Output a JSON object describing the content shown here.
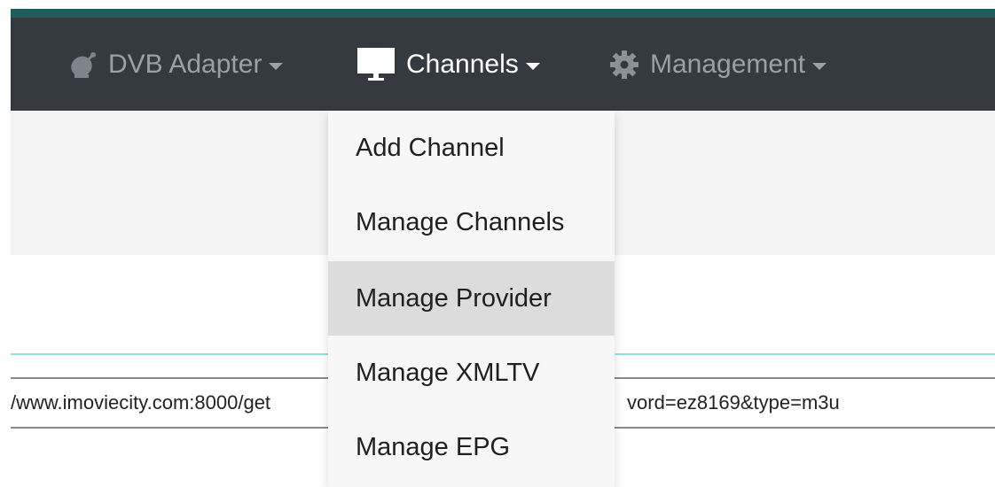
{
  "navbar": {
    "items": [
      {
        "label": "DVB Adapter",
        "icon": "satellite-dish-icon",
        "has_caret": true,
        "active": false
      },
      {
        "label": "Channels",
        "icon": "monitor-icon",
        "has_caret": true,
        "active": true
      },
      {
        "label": "Management",
        "icon": "gear-icon",
        "has_caret": true,
        "active": false
      }
    ]
  },
  "channels_menu": {
    "items": [
      {
        "label": "Add Channel"
      },
      {
        "label": "Manage Channels"
      },
      {
        "label": "Manage Provider",
        "highlighted": true
      },
      {
        "label": "Manage XMLTV"
      },
      {
        "label": "Manage EPG"
      }
    ]
  },
  "url_field": {
    "visible_left": "/www.imoviecity.com:8000/get",
    "visible_right": "vord=ez8169&type=m3u"
  },
  "colors": {
    "navbar_bg": "#343a40",
    "accent_bar": "#1f5e5b",
    "cyan_line": "#8fe0e6",
    "menu_highlight": "#dcdcdc"
  }
}
